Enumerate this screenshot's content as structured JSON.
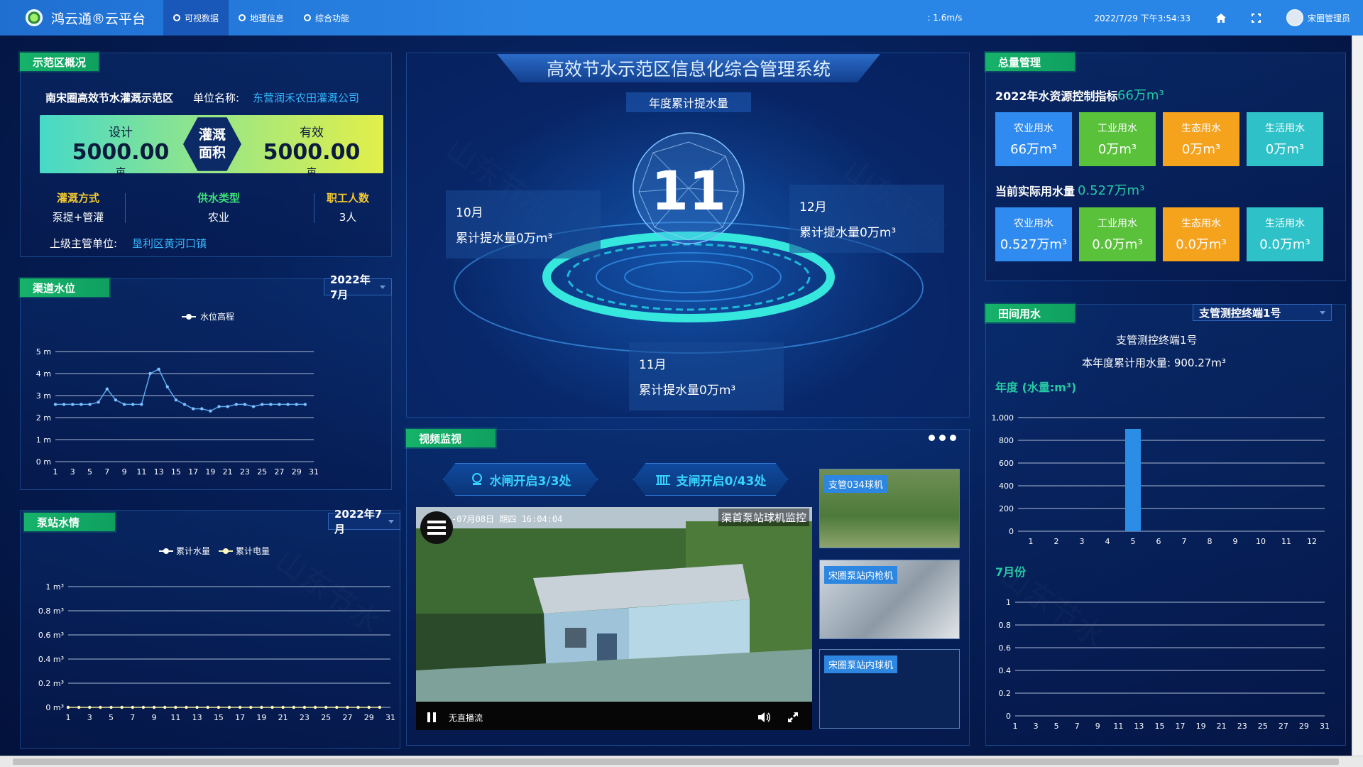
{
  "header": {
    "brand": "鸿云通®云平台",
    "tabs": [
      {
        "label": "可视数据",
        "active": true
      },
      {
        "label": "地理信息",
        "active": false
      },
      {
        "label": "综合功能",
        "active": false
      }
    ],
    "wind": ": 1.6m/s",
    "datetime": "2022/7/29 下午3:54:33",
    "user": "宋圈管理员"
  },
  "overview": {
    "title": "示范区概况",
    "area_name": "南宋圈高效节水灌溉示范区",
    "unit_label": "单位名称:",
    "unit_value": "东营润禾农田灌溉公司",
    "design_label": "设计",
    "design_value": "5000.00",
    "design_unit": "亩",
    "badge_line1": "灌溉",
    "badge_line2": "面积",
    "effective_label": "有效",
    "effective_value": "5000.00",
    "effective_unit": "亩",
    "irrigation_label": "灌溉方式",
    "irrigation_value": "泵提+管灌",
    "supply_label": "供水类型",
    "supply_value": "农业",
    "staff_label": "职工人数",
    "staff_value": "3人",
    "superior_label": "上级主管单位:",
    "superior_value": "垦利区黄河口镇"
  },
  "channel": {
    "title": "渠道水位",
    "month": "2022年7月",
    "legend": "水位高程",
    "chart_data": {
      "type": "line",
      "x": [
        1,
        2,
        3,
        4,
        5,
        6,
        7,
        8,
        9,
        10,
        11,
        12,
        13,
        14,
        15,
        16,
        17,
        18,
        19,
        20,
        21,
        22,
        23,
        24,
        25,
        26,
        27,
        28,
        29,
        30
      ],
      "series": [
        {
          "name": "水位高程",
          "values": [
            2.6,
            2.6,
            2.6,
            2.6,
            2.6,
            2.7,
            3.3,
            2.8,
            2.6,
            2.6,
            2.6,
            4.0,
            4.2,
            3.4,
            2.8,
            2.6,
            2.4,
            2.4,
            2.3,
            2.5,
            2.5,
            2.6,
            2.6,
            2.5,
            2.6,
            2.6,
            2.6,
            2.6,
            2.6,
            2.6
          ]
        }
      ],
      "y_ticks": [
        "0 m",
        "1 m",
        "2 m",
        "3 m",
        "4 m",
        "5 m"
      ],
      "x_ticks": [
        "1",
        "3",
        "5",
        "7",
        "9",
        "11",
        "13",
        "15",
        "17",
        "19",
        "21",
        "23",
        "25",
        "27",
        "29",
        "31"
      ],
      "ylim": [
        0,
        5
      ]
    }
  },
  "pump": {
    "title": "泵站水情",
    "month": "2022年7月",
    "legend_water": "累计水量",
    "legend_power": "累计电量",
    "chart_data": {
      "type": "line",
      "x": [
        1,
        2,
        3,
        4,
        5,
        6,
        7,
        8,
        9,
        10,
        11,
        12,
        13,
        14,
        15,
        16,
        17,
        18,
        19,
        20,
        21,
        22,
        23,
        24,
        25,
        26,
        27,
        28,
        29,
        30
      ],
      "series": [
        {
          "name": "累计水量",
          "values": [
            0,
            0,
            0,
            0,
            0,
            0,
            0,
            0,
            0,
            0,
            0,
            0,
            0,
            0,
            0,
            0,
            0,
            0,
            0,
            0,
            0,
            0,
            0,
            0,
            0,
            0,
            0,
            0,
            0,
            0
          ]
        }
      ],
      "y_ticks": [
        "0 m³",
        "0.2 m³",
        "0.4 m³",
        "0.6 m³",
        "0.8 m³",
        "1 m³"
      ],
      "x_ticks": [
        "1",
        "3",
        "5",
        "7",
        "9",
        "11",
        "13",
        "15",
        "17",
        "19",
        "21",
        "23",
        "25",
        "27",
        "29",
        "31"
      ],
      "ylim": [
        0,
        1
      ]
    }
  },
  "center": {
    "system_title": "高效节水示范区信息化综合管理系统",
    "annual_label": "年度累计提水量",
    "big_number": "11",
    "oct_title": "10月",
    "oct_value": "累计提水量0万m³",
    "dec_title": "12月",
    "dec_value": "累计提水量0万m³",
    "nov_title": "11月",
    "nov_value": "累计提水量0万m³"
  },
  "video": {
    "title": "视频监视",
    "gate_main": "水闸开启3/3处",
    "gate_branch": "支闸开启0/43处",
    "main_caption": "渠首泵站球机监控",
    "timestamp": "-07月08日 期四 16:04:04",
    "live_label": "无直播流",
    "thumbs": [
      "支管034球机",
      "宋圈泵站内枪机",
      "宋圈泵站内球机"
    ]
  },
  "total": {
    "title": "总量管理",
    "index_label": "2022年水资源控制指标",
    "index_value": "66万m³",
    "actual_label": "当前实际用水量",
    "actual_value": "0.527万m³",
    "row1": [
      {
        "label": "农业用水",
        "value": "66万m³",
        "color": "#2f8bef"
      },
      {
        "label": "工业用水",
        "value": "0万m³",
        "color": "#59c13a"
      },
      {
        "label": "生态用水",
        "value": "0万m³",
        "color": "#f5a21d"
      },
      {
        "label": "生活用水",
        "value": "0万m³",
        "color": "#2ec2c8"
      }
    ],
    "row2": [
      {
        "label": "农业用水",
        "value": "0.527万m³",
        "color": "#2f8bef"
      },
      {
        "label": "工业用水",
        "value": "0.0万m³",
        "color": "#59c13a"
      },
      {
        "label": "生态用水",
        "value": "0.0万m³",
        "color": "#f5a21d"
      },
      {
        "label": "生活用水",
        "value": "0.0万m³",
        "color": "#2ec2c8"
      }
    ]
  },
  "field": {
    "title": "田间用水",
    "terminal": "支管测控终端1号",
    "terminal_name": "支管测控终端1号",
    "annual_use": "本年度累计用水量: 900.27m³",
    "year_label": "年度 (水量:m³)",
    "month_label": "7月份",
    "chart_data": [
      {
        "type": "bar",
        "categories": [
          "1",
          "2",
          "3",
          "4",
          "5",
          "6",
          "7",
          "8",
          "9",
          "10",
          "11",
          "12"
        ],
        "values": [
          0,
          0,
          0,
          0,
          900.27,
          0,
          0,
          0,
          0,
          0,
          0,
          0
        ],
        "y_ticks": [
          "0",
          "200",
          "400",
          "600",
          "800",
          "1,000"
        ],
        "ylim": [
          0,
          1000
        ]
      },
      {
        "type": "line",
        "x": [
          1,
          2,
          3,
          4,
          5,
          6,
          7,
          8,
          9,
          10,
          11,
          12,
          13,
          14,
          15,
          16,
          17,
          18,
          19,
          20,
          21,
          22,
          23,
          24,
          25,
          26,
          27,
          28,
          29,
          30,
          31
        ],
        "y_ticks": [
          "0",
          "0.2",
          "0.4",
          "0.6",
          "0.8",
          "1"
        ],
        "x_ticks": [
          "1",
          "3",
          "5",
          "7",
          "9",
          "11",
          "13",
          "15",
          "17",
          "19",
          "21",
          "23",
          "25",
          "27",
          "29",
          "31"
        ],
        "ylim": [
          0,
          1
        ]
      }
    ]
  }
}
